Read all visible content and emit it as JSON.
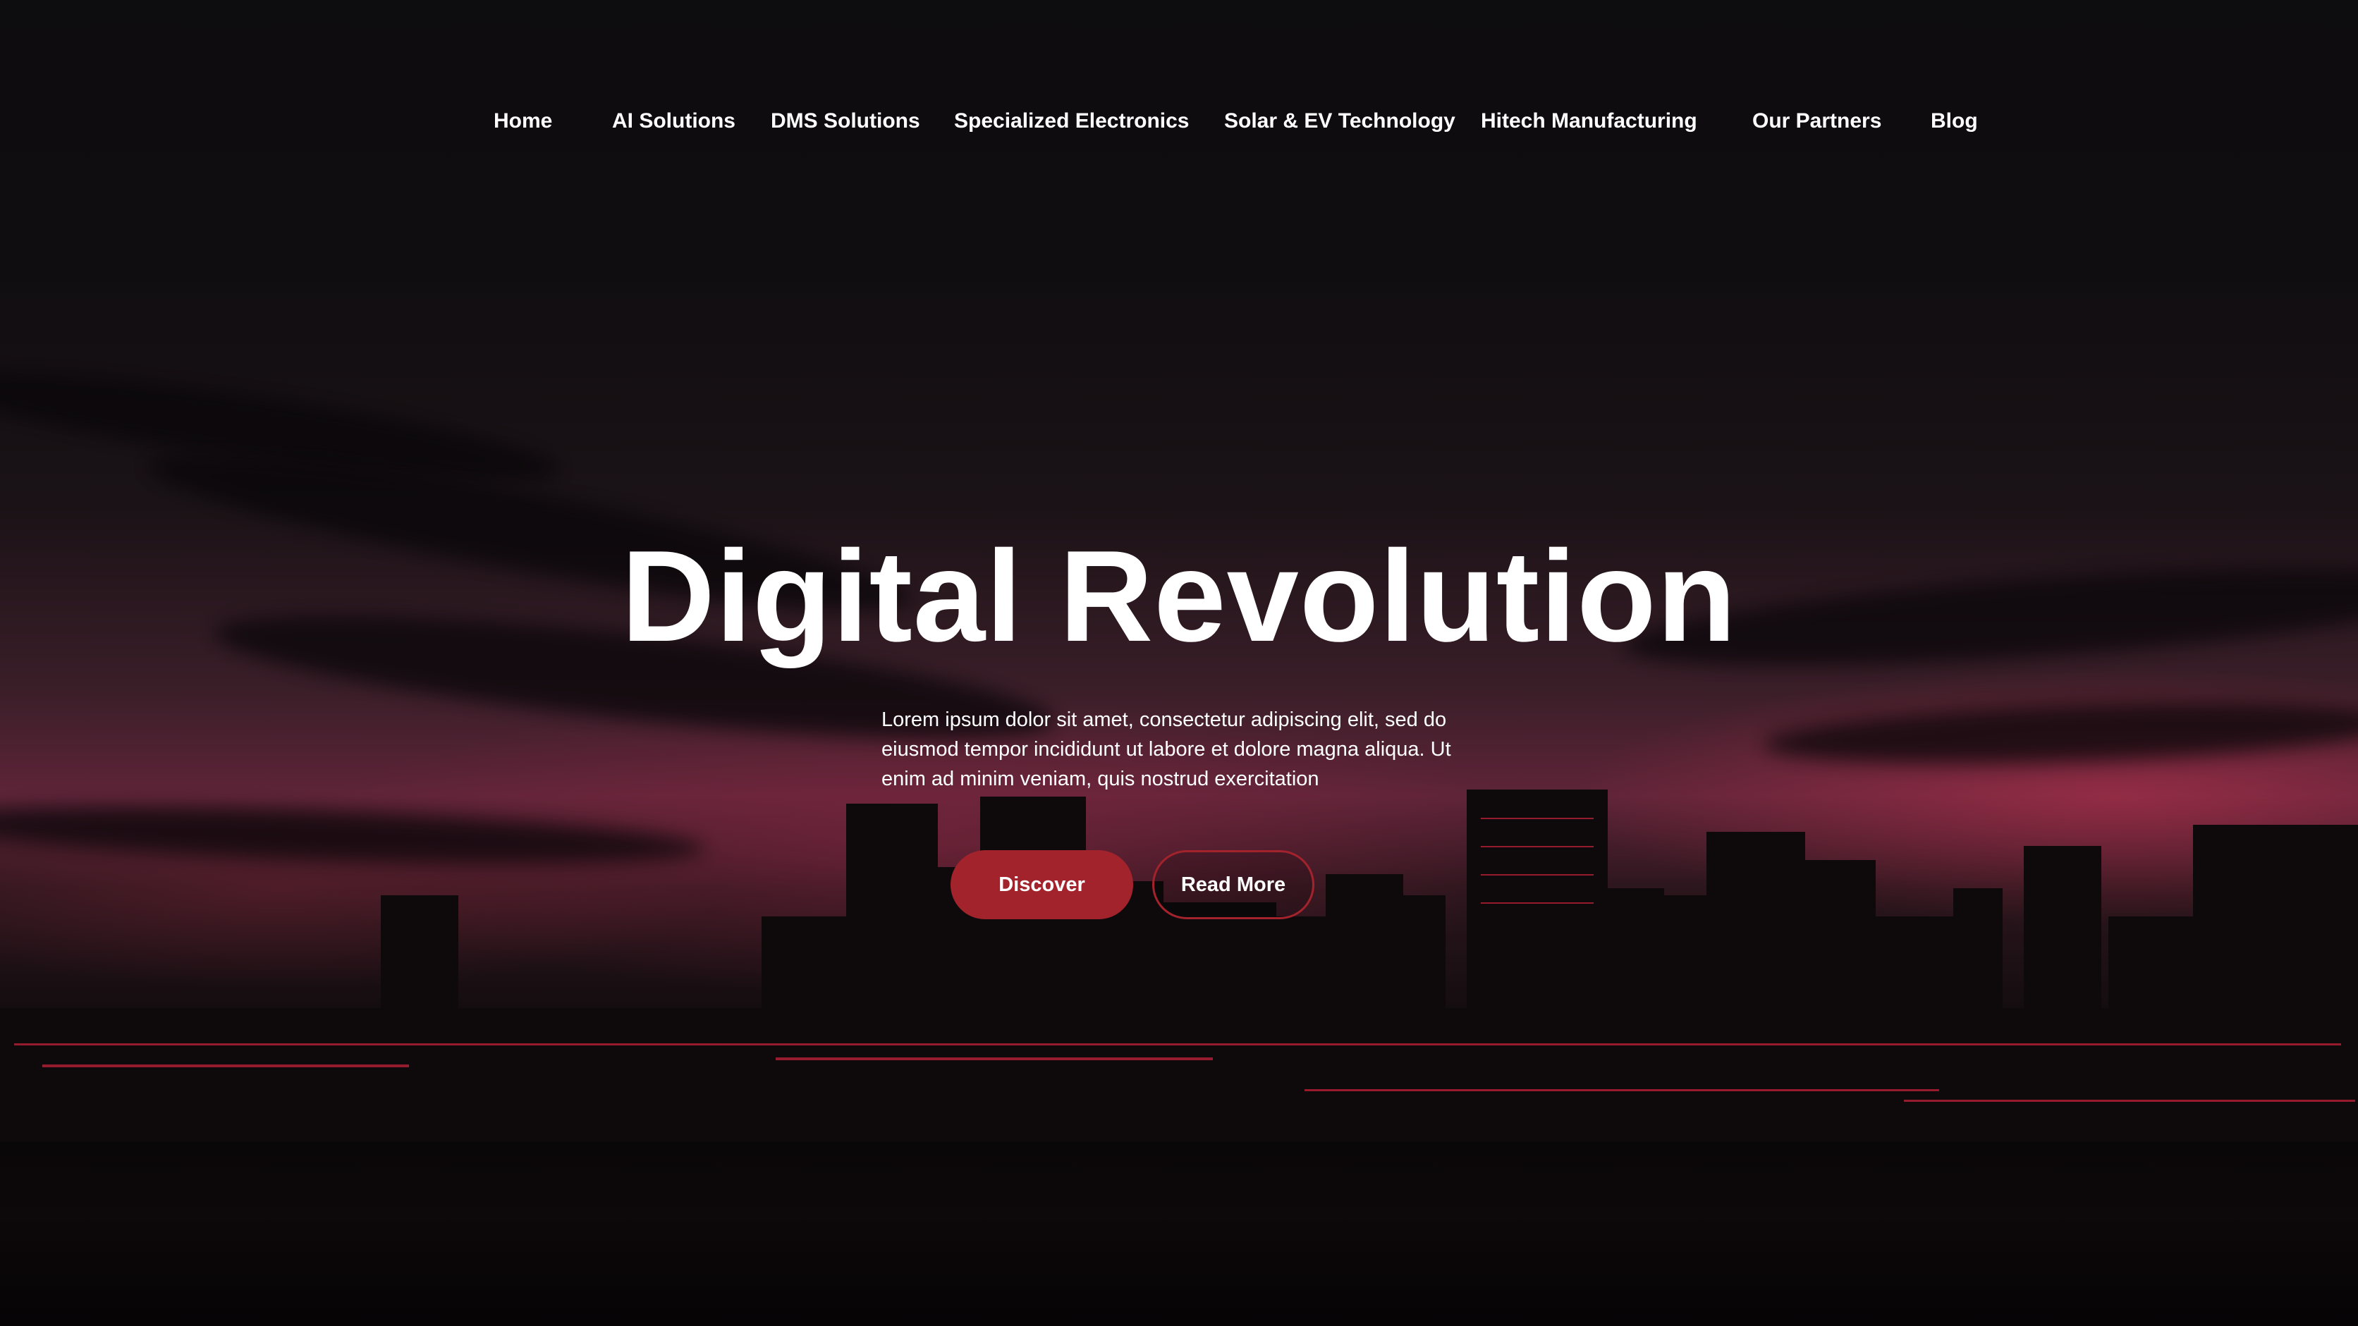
{
  "nav": {
    "items": [
      {
        "label": "Home"
      },
      {
        "label": "AI Solutions"
      },
      {
        "label": "DMS Solutions"
      },
      {
        "label": "Specialized Electronics"
      },
      {
        "label": "Solar & EV Technology"
      },
      {
        "label": "Hitech Manufacturing"
      },
      {
        "label": "Our Partners"
      },
      {
        "label": "Blog"
      }
    ]
  },
  "hero": {
    "title": "Digital Revolution",
    "description": "Lorem ipsum dolor sit amet, consectetur adipiscing elit, sed do eiusmod tempor incididunt ut labore et dolore magna aliqua. Ut enim ad minim veniam, quis nostrud exercitation",
    "primary_button": "Discover",
    "secondary_button": "Read More"
  },
  "colors": {
    "accent": "#a3232c",
    "background": "#0c0b0d",
    "text": "#ffffff"
  }
}
